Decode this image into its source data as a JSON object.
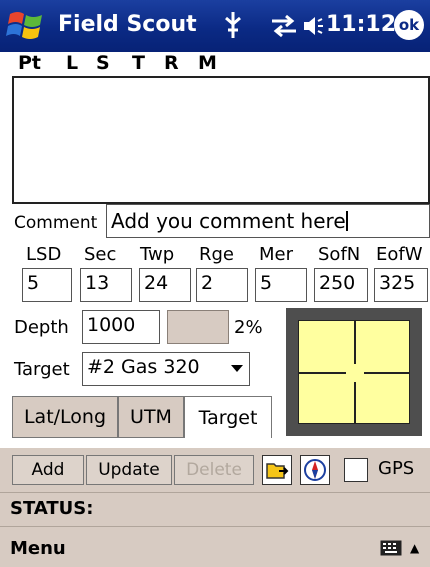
{
  "titlebar": {
    "app_name": "Field Scout",
    "time": "11:12",
    "ok_label": "ok",
    "icons": [
      "windows-start-icon",
      "antenna-icon",
      "connectivity-icon",
      "speaker-icon"
    ]
  },
  "column_header": [
    "Pt",
    "L",
    "S",
    "T",
    "R",
    "M"
  ],
  "comment": {
    "label": "Comment",
    "value": "Add you comment here"
  },
  "location": {
    "labels": [
      "LSD",
      "Sec",
      "Twp",
      "Rge",
      "Mer",
      "SofN",
      "EofW"
    ],
    "values": [
      "5",
      "13",
      "24",
      "2",
      "5",
      "250",
      "325"
    ]
  },
  "depth": {
    "label": "Depth",
    "value": "1000",
    "percent": "2%"
  },
  "target": {
    "label": "Target",
    "selected": "#2 Gas 320"
  },
  "tabs": [
    {
      "label": "Lat/Long",
      "active": false
    },
    {
      "label": "UTM",
      "active": false
    },
    {
      "label": "Target",
      "active": true
    }
  ],
  "buttons": {
    "add": "Add",
    "update": "Update",
    "delete": "Delete",
    "gps_label": "GPS",
    "gps_checked": false
  },
  "status": {
    "label": "STATUS:"
  },
  "menubar": {
    "menu_label": "Menu"
  },
  "colors": {
    "titlebar": "#0b2a85",
    "chrome": "#d7cbc2",
    "target_area": "#ffff9f",
    "target_frame": "#4e4e4e"
  }
}
